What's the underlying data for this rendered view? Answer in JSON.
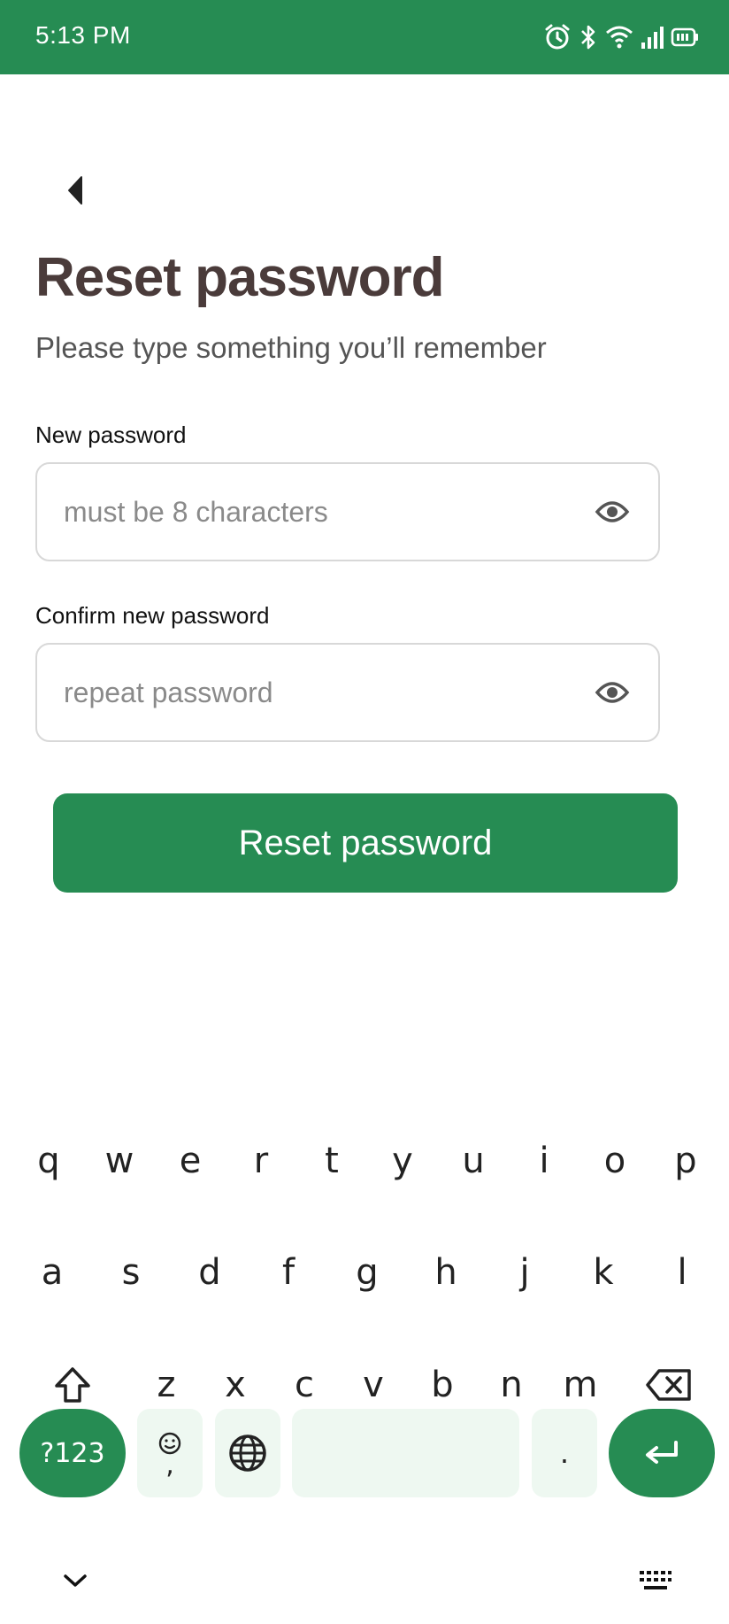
{
  "status_bar": {
    "time": "5:13 PM",
    "icons": [
      "alarm-icon",
      "bluetooth-icon",
      "wifi-icon",
      "signal-icon",
      "battery-icon"
    ]
  },
  "header": {
    "back_icon": "back-arrow-icon",
    "title": "Reset password",
    "subtitle": "Please type something you’ll remember"
  },
  "form": {
    "new_password": {
      "label": "New password",
      "placeholder": "must be 8 characters",
      "value": "",
      "toggle_icon": "eye-icon"
    },
    "confirm_password": {
      "label": "Confirm new password",
      "placeholder": "repeat password",
      "value": "",
      "toggle_icon": "eye-icon"
    },
    "submit_label": "Reset password"
  },
  "keyboard": {
    "row1": [
      "q",
      "w",
      "e",
      "r",
      "t",
      "y",
      "u",
      "i",
      "o",
      "p"
    ],
    "row2": [
      "a",
      "s",
      "d",
      "f",
      "g",
      "h",
      "j",
      "k",
      "l"
    ],
    "row3": [
      "z",
      "x",
      "c",
      "v",
      "b",
      "n",
      "m"
    ],
    "symbols_label": "?123",
    "comma_label": ",",
    "period_label": ".",
    "icons": [
      "shift-icon",
      "backspace-icon",
      "emoji-icon",
      "globe-icon",
      "enter-icon",
      "collapse-keyboard-icon",
      "keyboard-switch-icon"
    ]
  },
  "colors": {
    "brand_green": "#268c53",
    "title_color": "#4a3b3a",
    "key_light": "#eef8f1"
  }
}
